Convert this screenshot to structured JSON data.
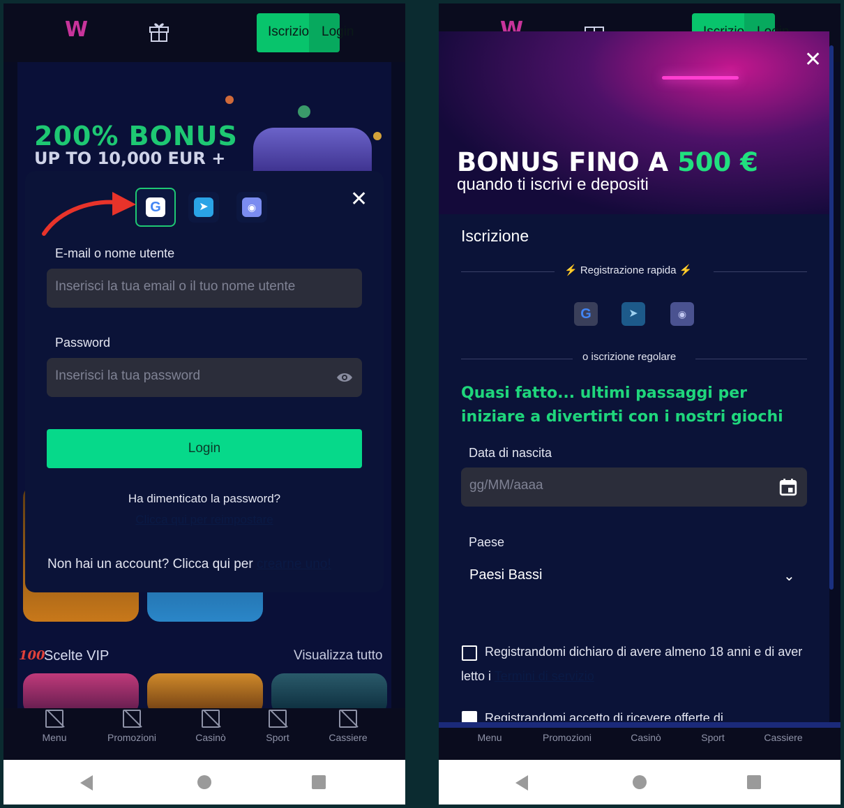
{
  "brand": {
    "logo": "W",
    "accent": "#06d98a",
    "bonus_green": "#21e07f"
  },
  "header": {
    "signup_label": "Iscrizione",
    "login_label": "Login"
  },
  "left": {
    "banner": {
      "line1": "200% BONUS",
      "line2": "UP TO 10,000 EUR +"
    },
    "login_modal": {
      "social_icons": [
        "google-icon",
        "telegram-icon",
        "discord-icon"
      ],
      "email_label": "E-mail o nome utente",
      "email_placeholder": "Inserisci la tua email o il tuo nome utente",
      "password_label": "Password",
      "password_placeholder": "Inserisci la tua password",
      "login_button": "Login",
      "forgot_text": "Ha dimenticato la password?",
      "reset_link": "Clicca qui per reimpostare",
      "no_account_text": "Non hai un account? Clicca qui per ",
      "create_link": "crearne uno!"
    },
    "vip": {
      "title": "Scelte VIP",
      "view_all": "Visualizza tutto"
    }
  },
  "right": {
    "banner": {
      "title_prefix": "BONUS FINO A ",
      "title_amount": "500 €",
      "subtitle": "quando ti iscrivi e depositi"
    },
    "section_title": "Iscrizione",
    "quick_reg": "⚡ Registrazione rapida ⚡",
    "regular_reg": "o iscrizione regolare",
    "message": "Quasi fatto... ultimi passaggi per iniziare a divertirti con i nostri giochi",
    "dob_label": "Data di nascita",
    "dob_placeholder": "gg/MM/aaaa",
    "country_label": "Paese",
    "country_value": "Paesi Bassi",
    "terms_text": "Registrandomi dichiaro di avere almeno 18 anni e di aver letto i ",
    "terms_link": "Termini di servizio",
    "offers_text": "Registrandomi accetto di ricevere offerte di"
  },
  "bottom_nav": [
    "Menu",
    "Promozioni",
    "Casinò",
    "Sport",
    "Cassiere"
  ]
}
